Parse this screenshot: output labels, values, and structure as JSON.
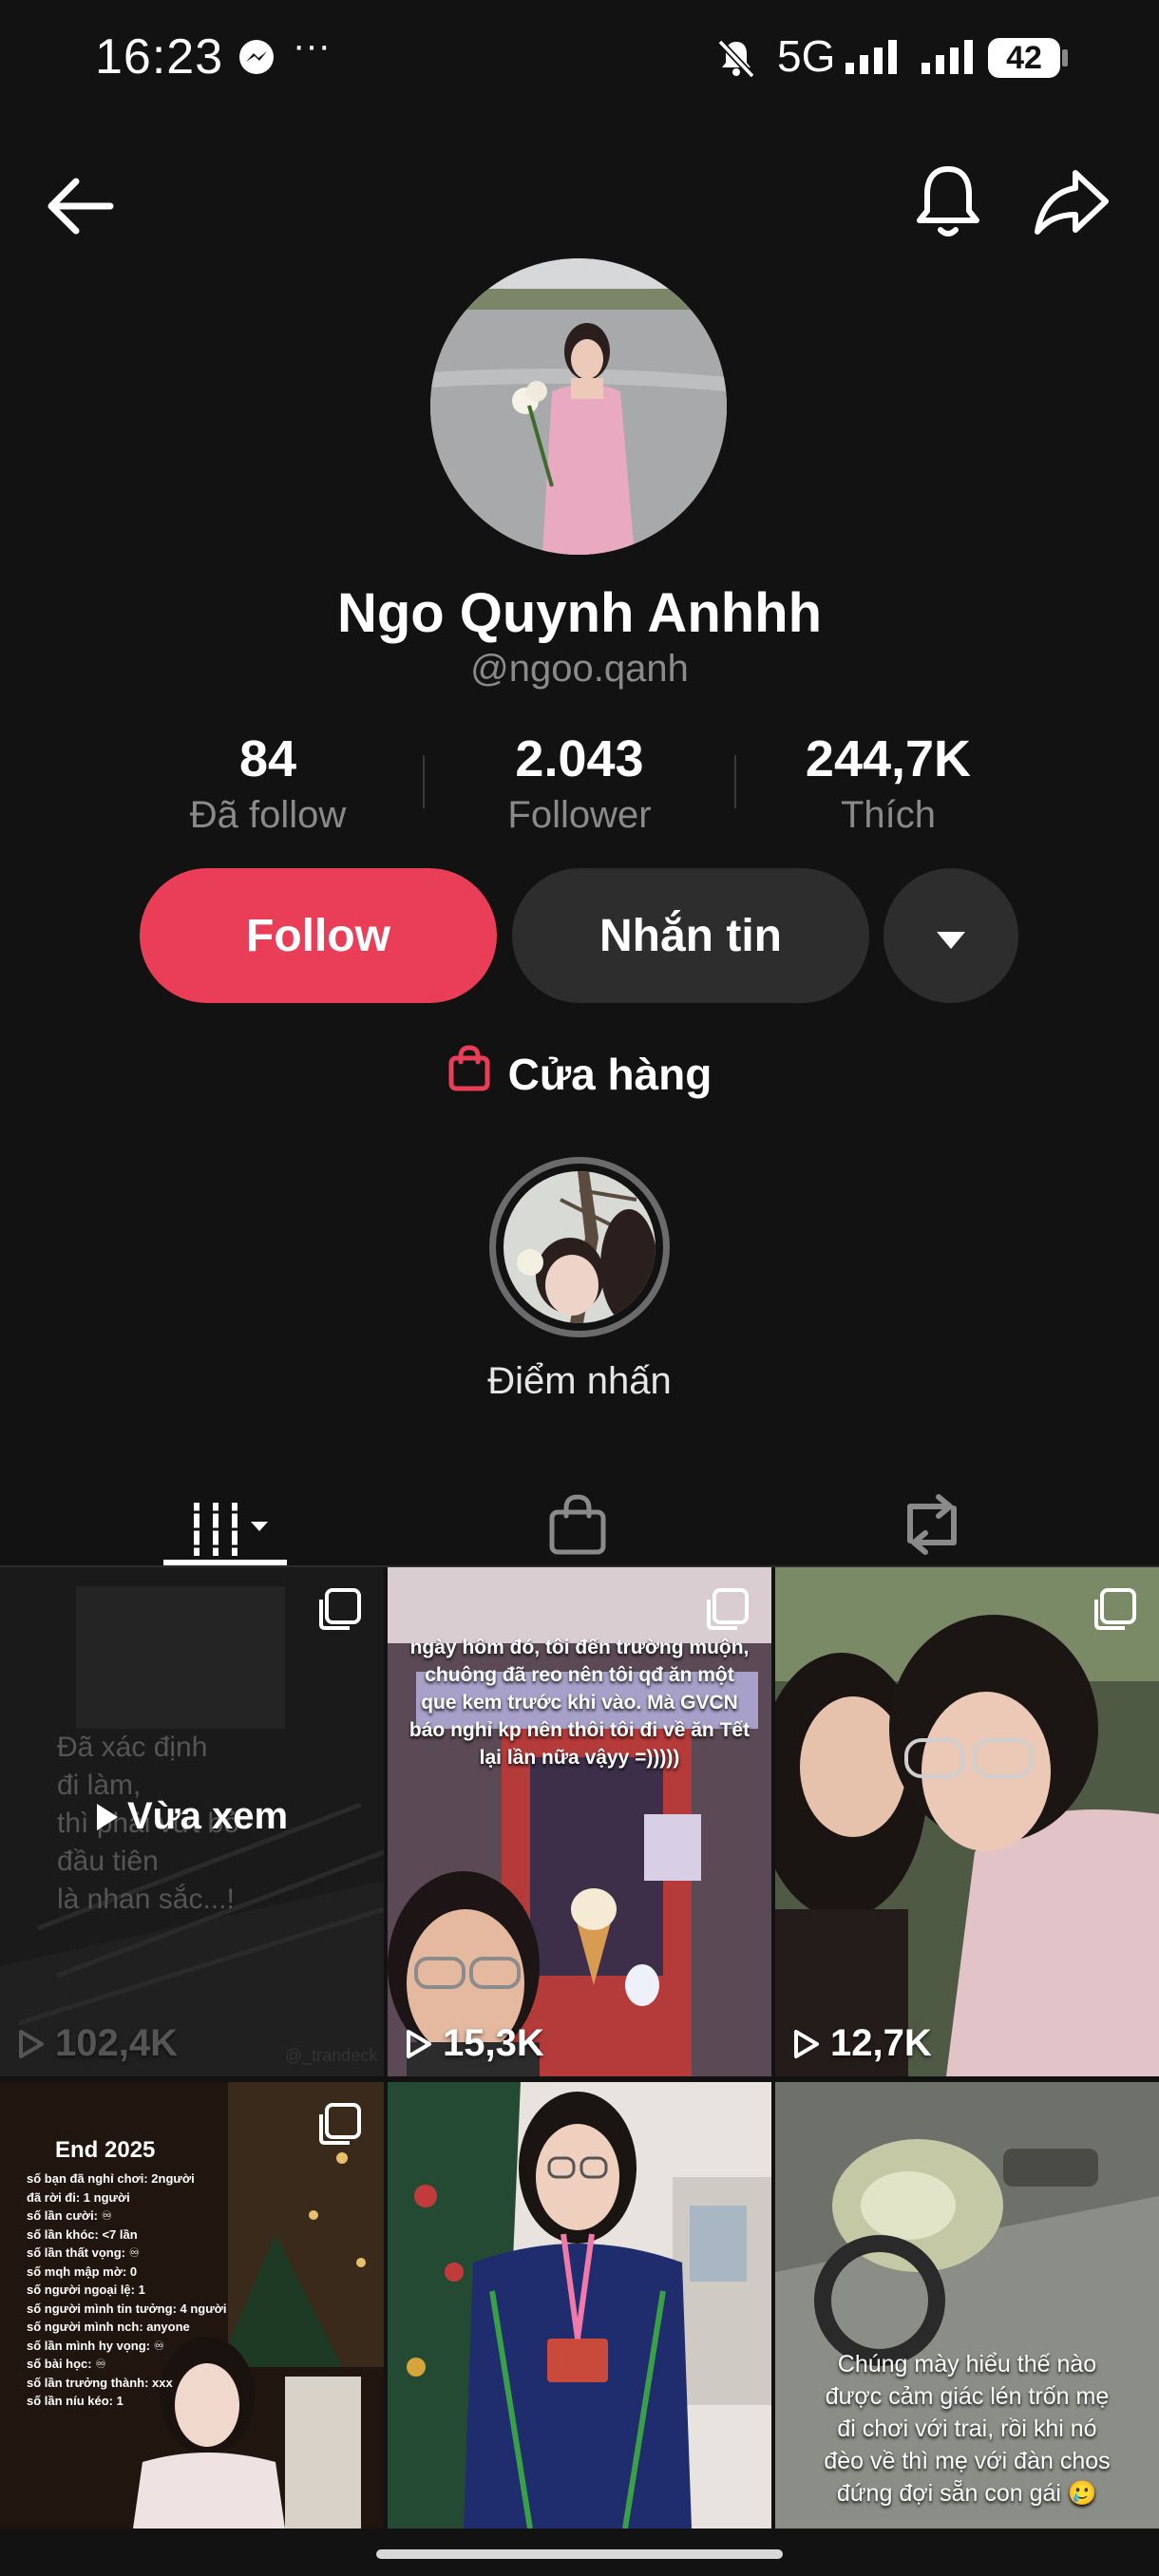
{
  "status_bar": {
    "time": "16:23",
    "more": "···",
    "network": "5G",
    "battery": "42"
  },
  "profile": {
    "display_name": "Ngo Quynh Anhhh",
    "username": "@ngoo.qanh",
    "stats": [
      {
        "value": "84",
        "label": "Đã follow"
      },
      {
        "value": "2.043",
        "label": "Follower"
      },
      {
        "value": "244,7K",
        "label": "Thích"
      }
    ],
    "follow_label": "Follow",
    "message_label": "Nhắn tin",
    "shop_label": "Cửa hàng",
    "highlight_label": "Điểm nhấn"
  },
  "videos": [
    {
      "views": "102,4K",
      "watched_label": "Vừa xem",
      "caption_lines": [
        "Đã xác định",
        "đi làm,",
        "thì phải vứt bỏ",
        "đầu tiên",
        "là nhan sắc...!"
      ],
      "watermark": "@_trandeck"
    },
    {
      "views": "15,3K",
      "caption_lines": [
        "ngày hôm đó, tôi đến trường muộn,",
        "chuông đã reo nên tôi qđ ăn một",
        "que kem trước khi vào. Mà GVCN",
        "báo nghỉ kp nên thôi tôi đi về ăn Tết",
        "lại lần nữa vậyy =)))))"
      ]
    },
    {
      "views": "12,7K"
    },
    {
      "title": "End 2025",
      "caption_lines": [
        "số bạn đã nghỉ chơi: 2người",
        "đã rời đi: 1 người",
        "số lần cười: ♾",
        "số lần khóc: <7 lần",
        "số lần thất vọng: ♾",
        "số mqh mập mờ: 0",
        "số người ngoại lệ: 1",
        "số người mình tin tưởng: 4 người",
        "số người mình nch: anyone",
        "số lần mình hy vọng: ♾",
        "số bài học: ♾",
        "số lần trưởng thành: xxx",
        "số lần níu kéo: 1"
      ]
    },
    {},
    {
      "caption_lines": [
        "Chúng mày hiểu thế nào",
        "được cảm giác lén trốn mẹ",
        "đi chơi với trai, rồi khi nó",
        "đèo về thì mẹ với đàn chos",
        "đứng đợi sẵn con gái 🥲"
      ]
    }
  ],
  "colors": {
    "accent": "#EA3D57",
    "background": "#121212",
    "button_dark": "#2D2D2D"
  }
}
